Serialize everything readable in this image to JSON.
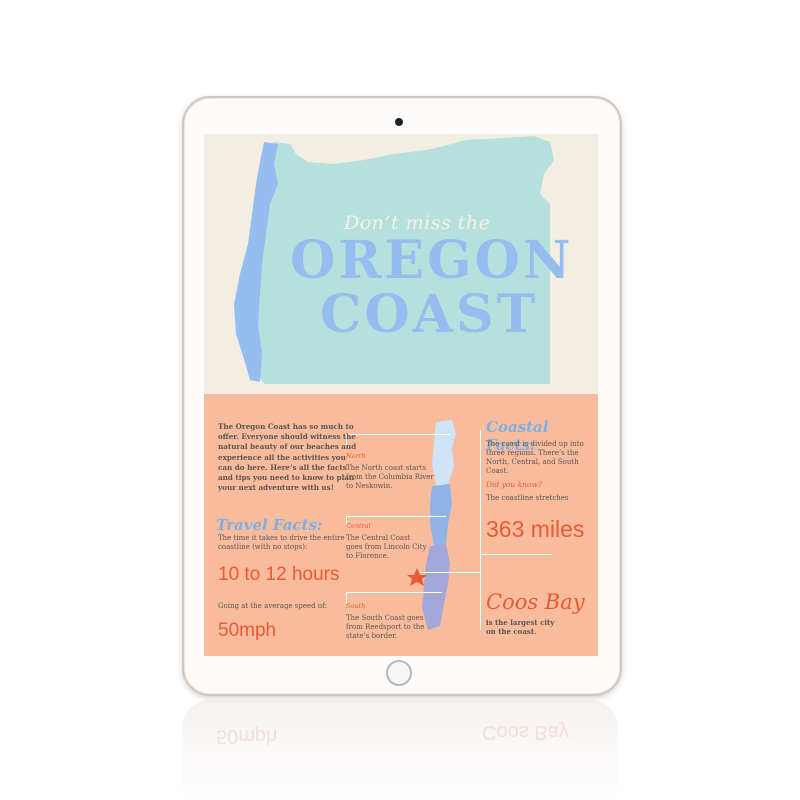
{
  "hero": {
    "subtitle": "Don’t miss the",
    "title_line1": "OREGON",
    "title_line2": "COAST"
  },
  "intro": {
    "text": "The Oregon Coast has so much to offer. Everyone should witness the natural beauty of our beaches and experience all the activities you can do here. Here’s all the facts and tips you need to know to plan your next adventure with us!"
  },
  "travel_facts": {
    "heading": "Travel Facts:",
    "drive_text": "The time it takes to drive the entire coastline (with no stops):",
    "drive_time": "10 to 12 hours",
    "speed_text": "Going at the average speed of:",
    "speed": "50mph"
  },
  "regions": {
    "north": {
      "label": "North",
      "text": "The North coast starts from the Columbia River to Neskowin."
    },
    "central": {
      "label": "Central",
      "text": "The Central Coast goes from Lincoln City to Florence."
    },
    "south": {
      "label": "South",
      "text": "The South Coast goes from Reedsport to the state’s border."
    }
  },
  "coastal_facts": {
    "heading": "Coastal Facts:",
    "regions_text": "The coast is divided up into three regions. There’s the North, Central, and South Coast.",
    "did_you_know": "Did you know?",
    "stretch_text": "The coastline stretches",
    "miles": "363 miles",
    "city": "Coos Bay",
    "city_text": "is the largest city on the coast."
  },
  "colors": {
    "cream": "#f3eee2",
    "peach": "#f8bc9d",
    "mint": "#b5e0dd",
    "blue": "#95bdf0",
    "orange": "#ea5a33",
    "text": "#5b5452"
  }
}
